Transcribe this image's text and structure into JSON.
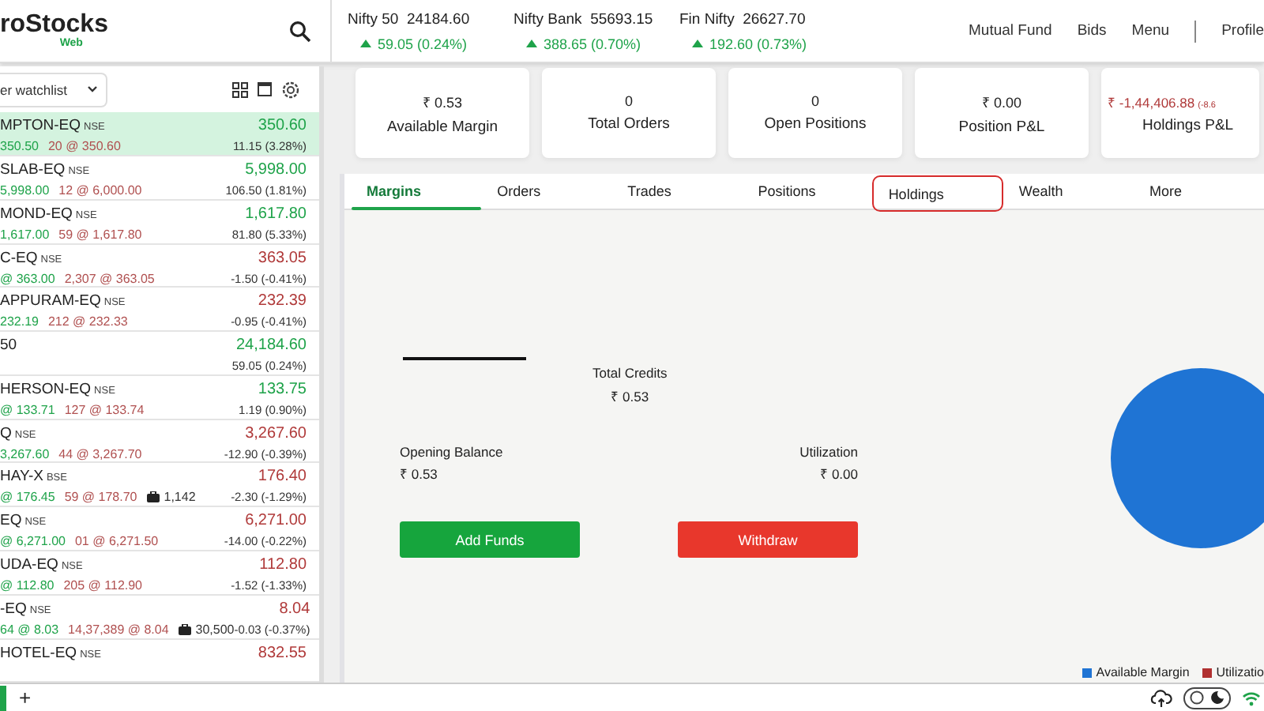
{
  "header": {
    "logo": "roStocks",
    "logo_sub": "Web",
    "indices": [
      {
        "name": "Nifty 50",
        "value": "24184.60",
        "change": "59.05 (0.24%)",
        "color": "#1fa34a"
      },
      {
        "name": "Nifty Bank",
        "value": "55693.15",
        "change": "388.65 (0.70%)",
        "color": "#1fa34a"
      },
      {
        "name": "Fin Nifty",
        "value": "26627.70",
        "change": "192.60 (0.73%)",
        "color": "#1fa34a"
      }
    ],
    "nav": [
      "Mutual Fund",
      "Bids",
      "Menu",
      "Profile"
    ]
  },
  "watchlist": {
    "selector": "er watchlist",
    "rows": [
      {
        "name": "MPTON-EQ",
        "exchange": "NSE",
        "bid": "350.50",
        "ask": "20 @ 350.60",
        "ltp": "350.60",
        "change": "11.15 (3.28%)",
        "color": "#1fa34a",
        "selected": true
      },
      {
        "name": "SLAB-EQ",
        "exchange": "NSE",
        "bid": "5,998.00",
        "ask": "12 @ 6,000.00",
        "ltp": "5,998.00",
        "change": "106.50 (1.81%)",
        "color": "#1fa34a",
        "selected": false
      },
      {
        "name": "MOND-EQ",
        "exchange": "NSE",
        "bid": "1,617.00",
        "ask": "59 @ 1,617.80",
        "ltp": "1,617.80",
        "change": "81.80 (5.33%)",
        "color": "#1fa34a",
        "selected": false
      },
      {
        "name": "C-EQ",
        "exchange": "NSE",
        "bid": "@ 363.00",
        "ask": "2,307 @ 363.05",
        "ltp": "363.05",
        "change": "-1.50 (-0.41%)",
        "color": "#b03a3a",
        "selected": false
      },
      {
        "name": "APPURAM-EQ",
        "exchange": "NSE",
        "bid": "232.19",
        "ask": "212 @ 232.33",
        "ltp": "232.39",
        "change": "-0.95 (-0.41%)",
        "color": "#b03a3a",
        "selected": false
      },
      {
        "name": "50",
        "ltp": "24,184.60",
        "change": "59.05 (0.24%)",
        "color": "#1fa34a",
        "selected": false
      },
      {
        "name": "HERSON-EQ",
        "exchange": "NSE",
        "bid": "@ 133.71",
        "ask": "127 @ 133.74",
        "ltp": "133.75",
        "change": "1.19 (0.90%)",
        "color": "#1fa34a",
        "selected": false
      },
      {
        "name": "Q",
        "exchange": "NSE",
        "bid": "3,267.60",
        "ask": "44 @ 3,267.70",
        "ltp": "3,267.60",
        "change": "-12.90 (-0.39%)",
        "color": "#b03a3a",
        "selected": false
      },
      {
        "name": "HAY-X",
        "exchange": "BSE",
        "bid": "@ 176.45",
        "ask": "59 @ 178.70",
        "holding": "1,142",
        "ltp": "176.40",
        "change": "-2.30 (-1.29%)",
        "color": "#b03a3a",
        "selected": false
      },
      {
        "name": "EQ",
        "exchange": "NSE",
        "bid": "@ 6,271.00",
        "ask": "01 @ 6,271.50",
        "ltp": "6,271.00",
        "change": "-14.00 (-0.22%)",
        "color": "#b03a3a",
        "selected": false
      },
      {
        "name": "UDA-EQ",
        "exchange": "NSE",
        "bid": "@ 112.80",
        "ask": "205 @ 112.90",
        "ltp": "112.80",
        "change": "-1.52 (-1.33%)",
        "color": "#b03a3a",
        "selected": false
      },
      {
        "name": "-EQ",
        "exchange": "NSE",
        "bid": "64 @ 8.03",
        "ask": "14,37,389 @ 8.04",
        "holding": "30,500",
        "ltp": "8.04",
        "change": "-0.03 (-0.37%)",
        "color": "#b03a3a",
        "selected": false
      },
      {
        "name": "HOTEL-EQ",
        "exchange": "NSE",
        "ltp": "832.55",
        "color": "#b03a3a",
        "selected": false
      }
    ]
  },
  "summary_cards": [
    {
      "value": "₹ 0.53",
      "label": "Available Margin"
    },
    {
      "value": "0",
      "label": "Total Orders"
    },
    {
      "value": "0",
      "label": "Open Positions"
    },
    {
      "value": "₹ 0.00",
      "label": "Position P&L"
    },
    {
      "value": "₹ -1,44,406.88",
      "extra": "(-8.6",
      "label": "Holdings P&L",
      "color": "#b03a3a"
    }
  ],
  "tabs": [
    {
      "label": "Margins",
      "selected": true,
      "highlighted": false
    },
    {
      "label": "Orders",
      "selected": false,
      "highlighted": false
    },
    {
      "label": "Trades",
      "selected": false,
      "highlighted": false
    },
    {
      "label": "Positions",
      "selected": false,
      "highlighted": false
    },
    {
      "label": "Holdings",
      "selected": false,
      "highlighted": true
    },
    {
      "label": "Wealth",
      "selected": false,
      "highlighted": false
    },
    {
      "label": "More",
      "selected": false,
      "highlighted": false
    }
  ],
  "margins": {
    "total_credits": {
      "label": "Total Credits",
      "value": "₹ 0.53"
    },
    "opening_balance": {
      "label": "Opening Balance",
      "value": "₹ 0.53"
    },
    "utilization": {
      "label": "Utilization",
      "value": "₹ 0.00"
    },
    "buttons": [
      {
        "label": "Add Funds",
        "kind": "add"
      },
      {
        "label": "Withdraw",
        "kind": "withdraw"
      }
    ],
    "legend": [
      {
        "label": "Available Margin",
        "color": "#1f74d4"
      },
      {
        "label": "Utilizatio",
        "color": "#b03030"
      }
    ]
  },
  "footer": {
    "add_tab": "+",
    "theme_toggle": {
      "on": false
    }
  }
}
